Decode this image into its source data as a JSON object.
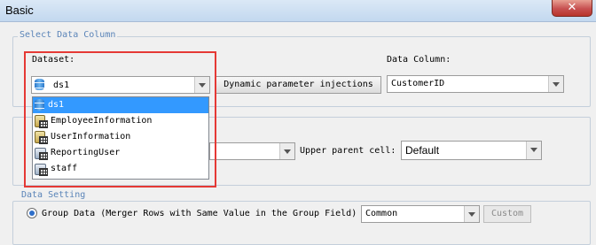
{
  "window": {
    "title": "Basic",
    "close_glyph": "✕"
  },
  "select_data_column": {
    "legend": "Select Data Column",
    "dataset_label": "Dataset:",
    "dataset_value": "ds1",
    "dynamic_button": "Dynamic parameter injections",
    "data_column_label": "Data Column:",
    "data_column_value": "CustomerID"
  },
  "dataset_dropdown": {
    "items": [
      {
        "label": "ds1",
        "icon": "database-icon",
        "selected": true
      },
      {
        "label": "EmployeeInformation",
        "icon": "table-icon",
        "selected": false
      },
      {
        "label": "UserInformation",
        "icon": "table-icon",
        "selected": false
      },
      {
        "label": "ReportingUser",
        "icon": "query-table-icon",
        "selected": false
      },
      {
        "label": "staff",
        "icon": "query-table-icon",
        "selected": false
      }
    ]
  },
  "parent_cell": {
    "upper_label": "Upper parent cell:",
    "upper_value": "Default"
  },
  "data_setting": {
    "legend": "Data Setting",
    "group_radio_label": "Group Data (Merger Rows with Same Value in the Group Field)",
    "group_value": "Common",
    "custom_button": "Custom"
  },
  "colors": {
    "legend_text": "#5a84b8",
    "selection": "#3399ff",
    "highlight": "#e53935"
  }
}
